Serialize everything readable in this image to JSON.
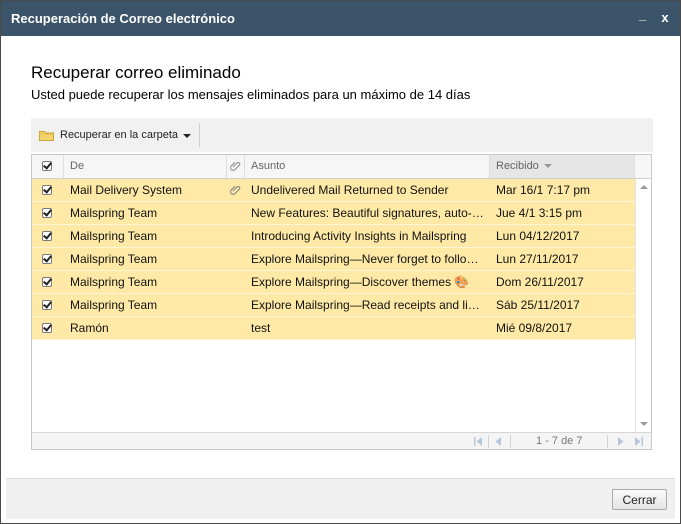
{
  "dialog": {
    "title": "Recuperación de Correo electrónico",
    "minimize_glyph": "_",
    "close_glyph": "x"
  },
  "content": {
    "heading": "Recuperar correo eliminado",
    "subheading": "Usted puede recuperar los mensajes eliminados para un máximo de 14 días"
  },
  "toolbar": {
    "recover_label": "Recuperar en la carpeta",
    "recover_icon": "folder-icon"
  },
  "grid": {
    "headers": {
      "from": "De",
      "attachment_icon": "paperclip-icon",
      "subject": "Asunto",
      "received": "Recibido"
    },
    "sorted_column": "received",
    "rows": [
      {
        "from": "Mail Delivery System",
        "attachment": true,
        "subject": "Undelivered Mail Returned to Sender",
        "received": "Mar 16/1 7:17 pm",
        "checked": true
      },
      {
        "from": "Mailspring Team",
        "attachment": false,
        "subject": "New Features: Beautiful signatures, auto-…",
        "received": "Jue 4/1 3:15 pm",
        "checked": true
      },
      {
        "from": "Mailspring Team",
        "attachment": false,
        "subject": "Introducing Activity Insights in Mailspring",
        "received": "Lun 04/12/2017",
        "checked": true
      },
      {
        "from": "Mailspring Team",
        "attachment": false,
        "subject": "Explore Mailspring—Never forget to follow…",
        "received": "Lun 27/11/2017",
        "checked": true
      },
      {
        "from": "Mailspring Team",
        "attachment": false,
        "subject": "Explore Mailspring—Discover themes 🎨",
        "received": "Dom 26/11/2017",
        "checked": true
      },
      {
        "from": "Mailspring Team",
        "attachment": false,
        "subject": "Explore Mailspring—Read receipts and lin…",
        "received": "Sáb 25/11/2017",
        "checked": true
      },
      {
        "from": "Ramón",
        "attachment": false,
        "subject": "test",
        "received": "Mié 09/8/2017",
        "checked": true
      }
    ]
  },
  "pager": {
    "info": "1 - 7 de 7"
  },
  "footer": {
    "close_label": "Cerrar"
  },
  "colors": {
    "titlebar": "#3c5469",
    "row_selected": "#feeaa6"
  }
}
